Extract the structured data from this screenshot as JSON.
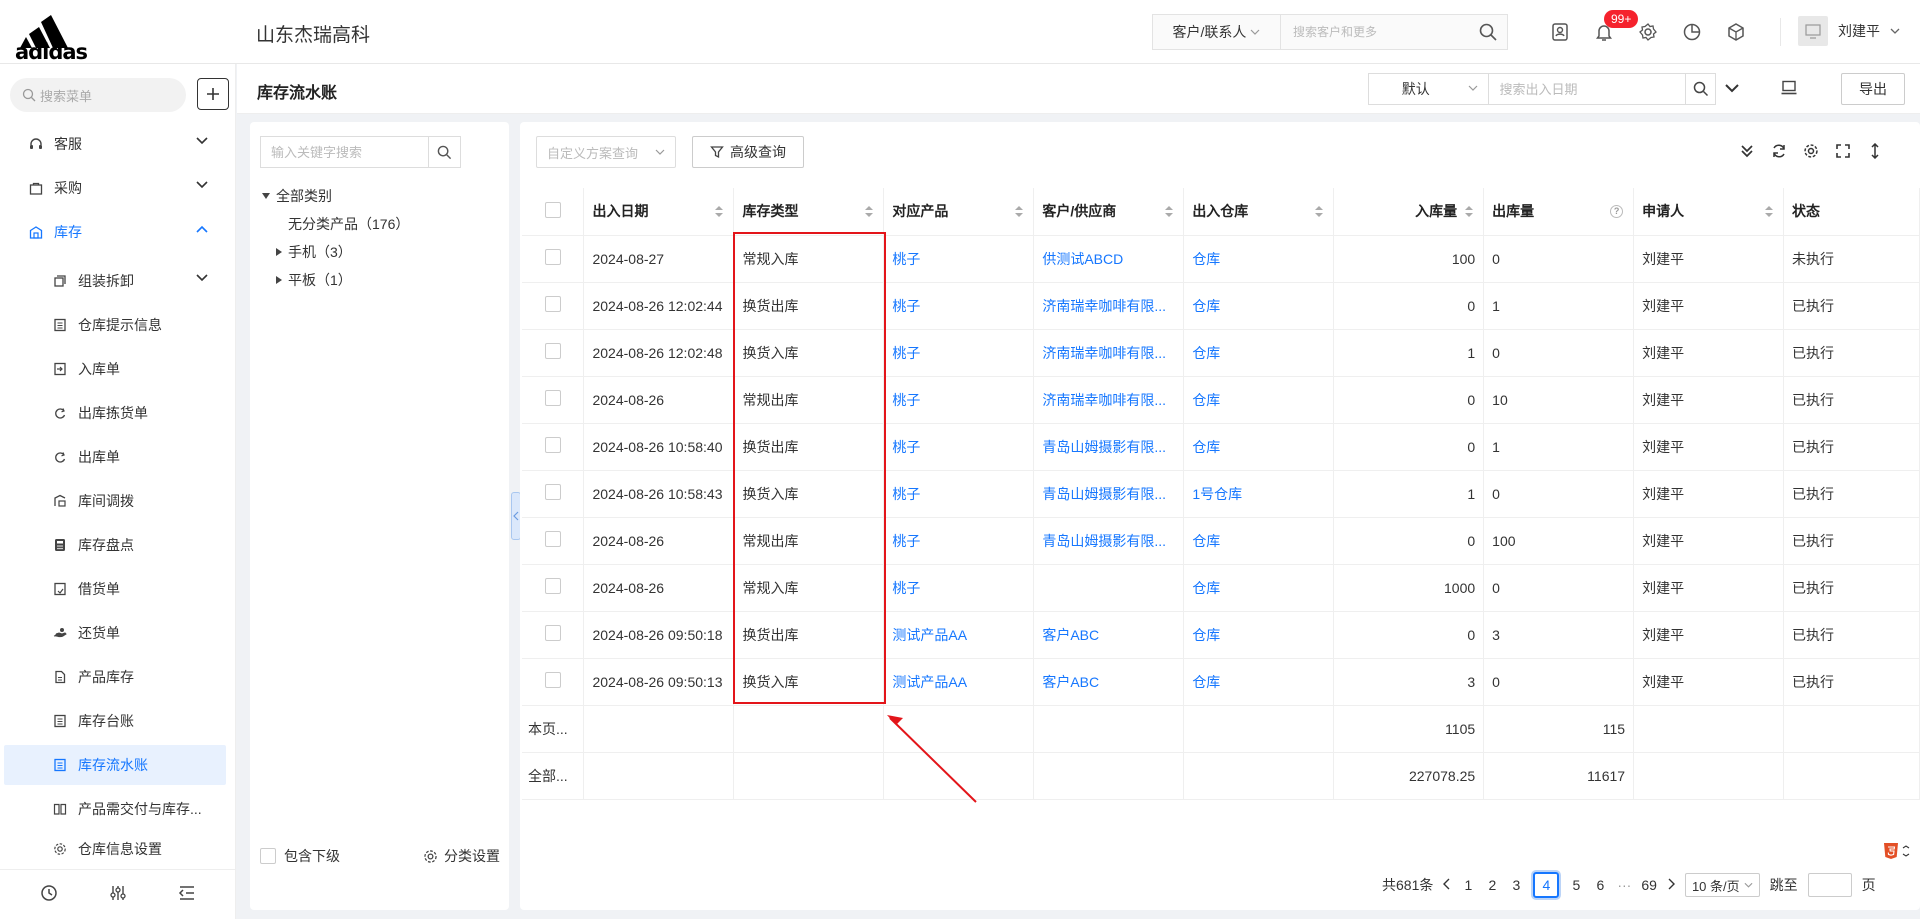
{
  "brand": {
    "logo_text": "adidas"
  },
  "header": {
    "company": "山东杰瑞高科",
    "search_type": "客户/联系人",
    "search_placeholder": "搜索客户和更多",
    "notification_badge": "99+",
    "user_name": "刘建平"
  },
  "sidebar": {
    "search_placeholder": "搜索菜单",
    "menu": [
      {
        "label": "客服",
        "icon": "headset-icon",
        "expanded": false
      },
      {
        "label": "采购",
        "icon": "bag-icon",
        "expanded": false
      },
      {
        "label": "库存",
        "icon": "warehouse-icon",
        "expanded": true
      }
    ],
    "submenu": [
      {
        "label": "组装拆卸",
        "icon": "copy-icon",
        "has_children": true
      },
      {
        "label": "仓库提示信息",
        "icon": "list-icon"
      },
      {
        "label": "入库单",
        "icon": "inbound-icon"
      },
      {
        "label": "出库拣货单",
        "icon": "picking-icon"
      },
      {
        "label": "出库单",
        "icon": "outbound-icon"
      },
      {
        "label": "库间调拨",
        "icon": "transfer-icon"
      },
      {
        "label": "库存盘点",
        "icon": "calculator-icon"
      },
      {
        "label": "借货单",
        "icon": "borrow-icon"
      },
      {
        "label": "还货单",
        "icon": "return-icon"
      },
      {
        "label": "产品库存",
        "icon": "file-icon"
      },
      {
        "label": "库存台账",
        "icon": "ledger-icon"
      },
      {
        "label": "库存流水账",
        "icon": "journal-icon",
        "active": true
      },
      {
        "label": "产品需交付与库存...",
        "icon": "book-icon"
      },
      {
        "label": "仓库信息设置",
        "icon": "gear-icon"
      }
    ]
  },
  "page": {
    "title": "库存流水账",
    "search_mode": "默认",
    "search_placeholder": "搜索出入日期",
    "export_label": "导出"
  },
  "tree": {
    "search_placeholder": "输入关键字搜索",
    "root": "全部类别",
    "nodes": [
      "无分类产品（176）",
      "手机（3）",
      "平板（1）"
    ],
    "include_sub_label": "包含下级",
    "settings_label": "分类设置"
  },
  "toolbar": {
    "plan_placeholder": "自定义方案查询",
    "advanced_label": "高级查询"
  },
  "table": {
    "headers": {
      "date": "出入日期",
      "type": "库存类型",
      "product": "对应产品",
      "partner": "客户/供应商",
      "warehouse": "出入仓库",
      "in_qty": "入库量",
      "out_qty": "出库量",
      "applicant": "申请人",
      "status": "状态"
    },
    "rows": [
      {
        "date": "2024-08-27",
        "type": "常规入库",
        "product": "桃子",
        "partner": "供测试ABCD",
        "warehouse": "仓库",
        "in": "100",
        "out": "0",
        "applicant": "刘建平",
        "status": "未执行"
      },
      {
        "date": "2024-08-26 12:02:44",
        "type": "换货出库",
        "product": "桃子",
        "partner": "济南瑞幸咖啡有限...",
        "warehouse": "仓库",
        "in": "0",
        "out": "1",
        "applicant": "刘建平",
        "status": "已执行"
      },
      {
        "date": "2024-08-26 12:02:48",
        "type": "换货入库",
        "product": "桃子",
        "partner": "济南瑞幸咖啡有限...",
        "warehouse": "仓库",
        "in": "1",
        "out": "0",
        "applicant": "刘建平",
        "status": "已执行"
      },
      {
        "date": "2024-08-26",
        "type": "常规出库",
        "product": "桃子",
        "partner": "济南瑞幸咖啡有限...",
        "warehouse": "仓库",
        "in": "0",
        "out": "10",
        "applicant": "刘建平",
        "status": "已执行"
      },
      {
        "date": "2024-08-26 10:58:40",
        "type": "换货出库",
        "product": "桃子",
        "partner": "青岛山姆摄影有限...",
        "warehouse": "仓库",
        "in": "0",
        "out": "1",
        "applicant": "刘建平",
        "status": "已执行"
      },
      {
        "date": "2024-08-26 10:58:43",
        "type": "换货入库",
        "product": "桃子",
        "partner": "青岛山姆摄影有限...",
        "warehouse": "1号仓库",
        "in": "1",
        "out": "0",
        "applicant": "刘建平",
        "status": "已执行"
      },
      {
        "date": "2024-08-26",
        "type": "常规出库",
        "product": "桃子",
        "partner": "青岛山姆摄影有限...",
        "warehouse": "仓库",
        "in": "0",
        "out": "100",
        "applicant": "刘建平",
        "status": "已执行"
      },
      {
        "date": "2024-08-26",
        "type": "常规入库",
        "product": "桃子",
        "partner": "",
        "warehouse": "仓库",
        "in": "1000",
        "out": "0",
        "applicant": "刘建平",
        "status": "已执行"
      },
      {
        "date": "2024-08-26 09:50:18",
        "type": "换货出库",
        "product": "测试产品AA",
        "partner": "客户ABC",
        "warehouse": "仓库",
        "in": "0",
        "out": "3",
        "applicant": "刘建平",
        "status": "已执行"
      },
      {
        "date": "2024-08-26 09:50:13",
        "type": "换货入库",
        "product": "测试产品AA",
        "partner": "客户ABC",
        "warehouse": "仓库",
        "in": "3",
        "out": "0",
        "applicant": "刘建平",
        "status": "已执行"
      }
    ],
    "summary": [
      {
        "label": "本页...",
        "in": "1105",
        "out": "115"
      },
      {
        "label": "全部...",
        "in": "227078.25",
        "out": "11617"
      }
    ]
  },
  "pagination": {
    "total": "共681条",
    "pages": [
      "1",
      "2",
      "3",
      "4",
      "5",
      "6"
    ],
    "current": "4",
    "ellipsis": "···",
    "last": "69",
    "page_size": "10 条/页",
    "jump_label": "跳至",
    "page_unit": "页"
  }
}
